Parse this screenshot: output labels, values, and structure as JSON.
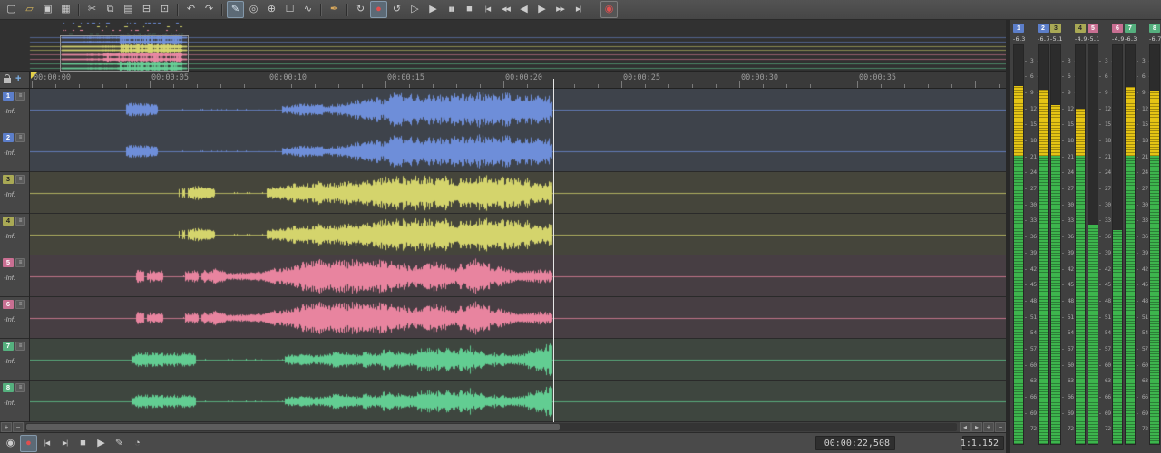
{
  "colors": {
    "blue": "#6e8ed9",
    "yellow": "#d4d46c",
    "pink": "#e8849f",
    "green": "#62cd92",
    "badge_blue": "#5c7ec9",
    "badge_yellow": "#a9a955",
    "badge_pink": "#c96f92",
    "badge_green": "#55b07e",
    "meter_green": "#3db54d",
    "meter_yellow": "#e5c414",
    "record_red": "#e04f4f"
  },
  "toolbar": {
    "buttons": [
      {
        "name": "new-file",
        "glyph": "▢"
      },
      {
        "name": "open-file",
        "glyph": "▱",
        "color": "#d7b75c"
      },
      {
        "name": "save",
        "glyph": "▣"
      },
      {
        "name": "save-all",
        "glyph": "▦"
      },
      {
        "sep": true
      },
      {
        "name": "cut",
        "glyph": "✂"
      },
      {
        "name": "copy",
        "glyph": "⧉"
      },
      {
        "name": "paste",
        "glyph": "▤"
      },
      {
        "name": "trim",
        "glyph": "⊟"
      },
      {
        "name": "crop",
        "glyph": "⊡"
      },
      {
        "sep": true
      },
      {
        "name": "undo",
        "glyph": "↶"
      },
      {
        "name": "redo",
        "glyph": "↷"
      },
      {
        "sep": true
      },
      {
        "name": "edit-tool",
        "glyph": "✎",
        "active": true,
        "color": "#dce8f2"
      },
      {
        "name": "magnify-tool",
        "glyph": "◎"
      },
      {
        "name": "zoom-tool",
        "glyph": "⊕"
      },
      {
        "name": "selection-tool",
        "glyph": "☐"
      },
      {
        "name": "envelope-tool",
        "glyph": "∿"
      },
      {
        "sep": true
      },
      {
        "name": "paint-tool",
        "glyph": "✒",
        "color": "#d7a75c"
      },
      {
        "sep": true
      },
      {
        "name": "loop-playback",
        "glyph": "↻"
      },
      {
        "name": "record",
        "glyph": "●",
        "color": "#e04f4f",
        "active": true
      },
      {
        "name": "loop-region",
        "glyph": "↺"
      },
      {
        "name": "play-from-start",
        "glyph": "▷"
      },
      {
        "name": "play",
        "glyph": "▶"
      },
      {
        "name": "pause",
        "glyph": "▮▮",
        "small": true
      },
      {
        "name": "stop",
        "glyph": "■"
      },
      {
        "name": "go-to-start",
        "glyph": "|◀",
        "small": true
      },
      {
        "name": "previous",
        "glyph": "◀◀",
        "small": true
      },
      {
        "name": "rewind",
        "glyph": "◀"
      },
      {
        "name": "forward",
        "glyph": "▶"
      },
      {
        "name": "next",
        "glyph": "▶▶",
        "small": true
      },
      {
        "name": "go-to-end",
        "glyph": "▶|",
        "small": true
      },
      {
        "name": "remote-record",
        "glyph": "◉",
        "color": "#e04f4f",
        "boxed": true
      }
    ]
  },
  "timeline": {
    "labels": [
      "00:00:00",
      "00:00:05",
      "00:00:10",
      "00:00:15",
      "00:00:20",
      "00:00:25",
      "00:00:30",
      "00:00:35"
    ],
    "seconds_per_label": 5
  },
  "playhead": {
    "time_seconds": 22.1
  },
  "tracks": [
    {
      "num": "1",
      "gain": "-Inf.",
      "color_key": "blue",
      "badge_key": "badge_blue",
      "wave": {
        "sparse_start": 4.0,
        "dense_start": 10.6,
        "end": 22.1
      }
    },
    {
      "num": "2",
      "gain": "-Inf.",
      "color_key": "blue",
      "badge_key": "badge_blue",
      "wave": {
        "sparse_start": 4.0,
        "dense_start": 10.6,
        "end": 22.1
      }
    },
    {
      "num": "3",
      "gain": "-Inf.",
      "color_key": "yellow",
      "badge_key": "badge_yellow",
      "wave": {
        "sparse_start": 6.2,
        "dense_start": 10.8,
        "end": 22.1
      }
    },
    {
      "num": "4",
      "gain": "-Inf.",
      "color_key": "yellow",
      "badge_key": "badge_yellow",
      "wave": {
        "sparse_start": 6.2,
        "dense_start": 10.8,
        "end": 22.1
      }
    },
    {
      "num": "5",
      "gain": "-Inf.",
      "color_key": "pink",
      "badge_key": "badge_pink",
      "wave": {
        "sparse_start": 4.4,
        "dense_start": 7.6,
        "end": 22.1
      }
    },
    {
      "num": "6",
      "gain": "-Inf.",
      "color_key": "pink",
      "badge_key": "badge_pink",
      "wave": {
        "sparse_start": 4.4,
        "dense_start": 7.6,
        "end": 22.1
      }
    },
    {
      "num": "7",
      "gain": "-Inf.",
      "color_key": "green",
      "badge_key": "badge_green",
      "wave": {
        "sparse_start": 4.2,
        "dense_start": 10.7,
        "end": 22.1
      }
    },
    {
      "num": "8",
      "gain": "-Inf.",
      "color_key": "green",
      "badge_key": "badge_green",
      "wave": {
        "sparse_start": 4.2,
        "dense_start": 10.7,
        "end": 22.1
      }
    }
  ],
  "meters": {
    "channels": [
      {
        "num": "1",
        "peak": "-6.3",
        "level_db": 8.0,
        "badge_key": "badge_blue"
      },
      {
        "num": "2",
        "peak": "-6.7",
        "level_db": 8.6,
        "badge_key": "badge_blue"
      },
      {
        "num": "3",
        "peak": "-5.1",
        "level_db": 11.6,
        "badge_key": "badge_yellow"
      },
      {
        "num": "4",
        "peak": "-4.9",
        "level_db": 12.2,
        "badge_key": "badge_yellow"
      },
      {
        "num": "5",
        "peak": "-5.1",
        "level_db": 34.0,
        "badge_key": "badge_pink"
      },
      {
        "num": "6",
        "peak": "-4.9",
        "level_db": 35.0,
        "badge_key": "badge_pink"
      },
      {
        "num": "7",
        "peak": "-6.3",
        "level_db": 8.2,
        "badge_key": "badge_green"
      },
      {
        "num": "8",
        "peak": "-6.7",
        "level_db": 8.8,
        "badge_key": "badge_green"
      }
    ],
    "scale": [
      "3",
      "6",
      "9",
      "12",
      "15",
      "18",
      "21",
      "24",
      "27",
      "30",
      "33",
      "36",
      "39",
      "42",
      "45",
      "48",
      "51",
      "54",
      "57",
      "60",
      "63",
      "66",
      "69",
      "72"
    ],
    "yellow_above_db": 21
  },
  "statusbar": {
    "buttons": [
      {
        "name": "arm-record",
        "glyph": "◉"
      },
      {
        "name": "record",
        "glyph": "●",
        "color": "#e04f4f",
        "active": true
      },
      {
        "name": "go-to-start",
        "glyph": "|◀",
        "small": true
      },
      {
        "name": "go-to-end",
        "glyph": "▶|",
        "small": true
      },
      {
        "name": "stop",
        "glyph": "■"
      },
      {
        "name": "play",
        "glyph": "▶"
      },
      {
        "name": "scrub-tool",
        "glyph": "✎"
      },
      {
        "name": "time-options",
        "glyph": "◔"
      }
    ],
    "time": "00:00:22,508",
    "ratio": "1:1.152"
  },
  "scrollbar": {
    "left": [
      {
        "name": "track-zoom-in",
        "glyph": "+"
      },
      {
        "name": "track-zoom-out",
        "glyph": "−"
      }
    ],
    "right": [
      {
        "name": "scroll-left",
        "glyph": "◂"
      },
      {
        "name": "scroll-right",
        "glyph": "▸"
      },
      {
        "name": "zoom-in",
        "glyph": "+"
      },
      {
        "name": "zoom-out",
        "glyph": "−"
      }
    ]
  }
}
